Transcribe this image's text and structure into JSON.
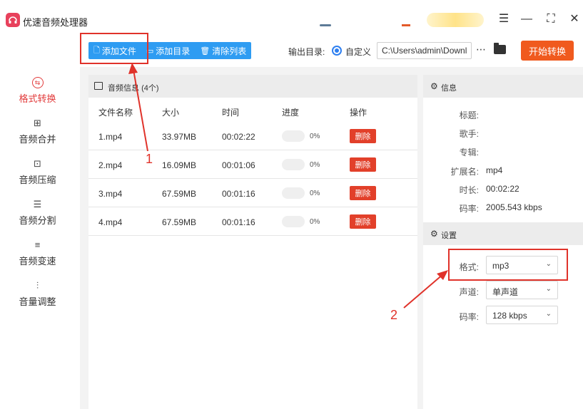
{
  "app": {
    "title": "优速音频处理器"
  },
  "toolbar": {
    "add_file": "添加文件",
    "add_dir": "添加目录",
    "clear_list": "清除列表",
    "output_label": "输出目录:",
    "custom_label": "自定义",
    "output_path": "C:\\Users\\admin\\Downlc",
    "start": "开始转换"
  },
  "sidebar": {
    "items": [
      {
        "label": "格式转换",
        "icon": "format-convert-icon",
        "active": true
      },
      {
        "label": "音频合并",
        "icon": "merge-icon"
      },
      {
        "label": "音频压缩",
        "icon": "compress-icon"
      },
      {
        "label": "音频分割",
        "icon": "split-icon"
      },
      {
        "label": "音频变速",
        "icon": "speed-icon"
      },
      {
        "label": "音量调整",
        "icon": "volume-icon"
      }
    ]
  },
  "file_list": {
    "title": "音频信息",
    "count": "(4个)",
    "columns": [
      "文件名称",
      "大小",
      "时间",
      "进度",
      "操作"
    ],
    "rows": [
      {
        "name": "1.mp4",
        "size": "33.97MB",
        "time": "00:02:22",
        "progress": 0,
        "pct": "0%",
        "action": "删除"
      },
      {
        "name": "2.mp4",
        "size": "16.09MB",
        "time": "00:01:06",
        "progress": 0,
        "pct": "0%",
        "action": "删除"
      },
      {
        "name": "3.mp4",
        "size": "67.59MB",
        "time": "00:01:16",
        "progress": 0,
        "pct": "0%",
        "action": "删除"
      },
      {
        "name": "4.mp4",
        "size": "67.59MB",
        "time": "00:01:16",
        "progress": 0,
        "pct": "0%",
        "action": "删除"
      }
    ]
  },
  "info": {
    "title": "信息",
    "fields": [
      {
        "label": "标题:",
        "value": ""
      },
      {
        "label": "歌手:",
        "value": ""
      },
      {
        "label": "专辑:",
        "value": ""
      },
      {
        "label": "扩展名:",
        "value": "mp4"
      },
      {
        "label": "时长:",
        "value": "00:02:22"
      },
      {
        "label": "码率:",
        "value": "2005.543 kbps"
      }
    ]
  },
  "settings": {
    "title": "设置",
    "format_label": "格式:",
    "format_value": "mp3",
    "channel_label": "声道:",
    "channel_value": "单声道",
    "bitrate_label": "码率:",
    "bitrate_value": "128 kbps"
  },
  "annotations": {
    "one": "1",
    "two": "2"
  },
  "colors": {
    "accent": "#2e9cf2",
    "start": "#f05a1e",
    "delete": "#e2402a",
    "annotation": "#e0322a",
    "active": "#e23b3b"
  }
}
